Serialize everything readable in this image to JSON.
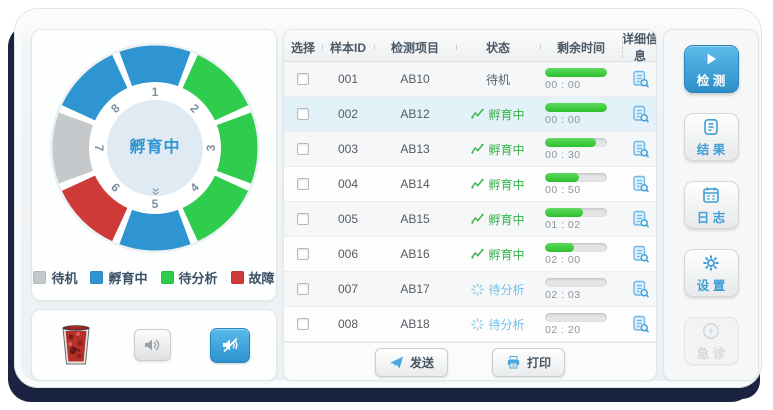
{
  "left_panel": {
    "center_label": "孵育中",
    "expand_chevron": "«",
    "legend": [
      {
        "label": "待机",
        "color": "#c6c9cb"
      },
      {
        "label": "孵育中",
        "color": "#2e94d2"
      },
      {
        "label": "待分析",
        "color": "#2fcc4e"
      },
      {
        "label": "故障",
        "color": "#cd3a37"
      }
    ]
  },
  "chart_data": {
    "type": "pie",
    "variant": "donut-status-ring",
    "center_label": "孵育中",
    "segments": [
      {
        "position": 1,
        "status": "孵育中",
        "color": "#2e94d2"
      },
      {
        "position": 2,
        "status": "待分析",
        "color": "#2fcc4e"
      },
      {
        "position": 3,
        "status": "待分析",
        "color": "#2fcc4e"
      },
      {
        "position": 4,
        "status": "待分析",
        "color": "#2fcc4e"
      },
      {
        "position": 5,
        "status": "孵育中",
        "color": "#2e94d2"
      },
      {
        "position": 6,
        "status": "故障",
        "color": "#cd3a37"
      },
      {
        "position": 7,
        "status": "待机",
        "color": "#c6c9cb"
      },
      {
        "position": 8,
        "status": "孵育中",
        "color": "#2e94d2"
      }
    ],
    "legend_position": "bottom"
  },
  "sound_panel": {
    "icons": [
      "waste-bin-icon",
      "speaker-on-icon",
      "speaker-muted-icon"
    ],
    "muted_button_active": true
  },
  "table": {
    "headers": [
      "选择",
      "样本ID",
      "检测项目",
      "状态",
      "剩余时间",
      "详细信息"
    ],
    "rows": [
      {
        "id": "001",
        "item": "AB10",
        "status": "待机",
        "status_type": "standby",
        "progress": 100,
        "time": "00 : 00",
        "selected": false,
        "checked": false
      },
      {
        "id": "002",
        "item": "AB12",
        "status": "孵育中",
        "status_type": "incubating",
        "progress": 100,
        "time": "00 : 00",
        "selected": true,
        "checked": false
      },
      {
        "id": "003",
        "item": "AB13",
        "status": "孵育中",
        "status_type": "incubating",
        "progress": 83,
        "time": "00 : 30",
        "selected": false,
        "checked": false
      },
      {
        "id": "004",
        "item": "AB14",
        "status": "孵育中",
        "status_type": "incubating",
        "progress": 55,
        "time": "00 : 50",
        "selected": false,
        "checked": false
      },
      {
        "id": "005",
        "item": "AB15",
        "status": "孵育中",
        "status_type": "incubating",
        "progress": 61,
        "time": "01 : 02",
        "selected": false,
        "checked": false
      },
      {
        "id": "006",
        "item": "AB16",
        "status": "孵育中",
        "status_type": "incubating",
        "progress": 47,
        "time": "02 : 00",
        "selected": false,
        "checked": false
      },
      {
        "id": "007",
        "item": "AB17",
        "status": "待分析",
        "status_type": "pending",
        "progress": 0,
        "time": "02 : 03",
        "selected": false,
        "checked": false
      },
      {
        "id": "008",
        "item": "AB18",
        "status": "待分析",
        "status_type": "pending",
        "progress": 0,
        "time": "02 : 20",
        "selected": false,
        "checked": false
      }
    ]
  },
  "footer": {
    "send_label": "发送",
    "print_label": "打印"
  },
  "sidebar": {
    "buttons": [
      {
        "label": "检 测",
        "icon": "play-icon",
        "state": "primary"
      },
      {
        "label": "结 果",
        "icon": "result-doc-icon",
        "state": "normal"
      },
      {
        "label": "日 志",
        "icon": "log-calendar-icon",
        "state": "normal"
      },
      {
        "label": "设 置",
        "icon": "settings-gear-icon",
        "state": "normal"
      },
      {
        "label": "急 诊",
        "icon": "emergency-bolt-icon",
        "state": "disabled"
      }
    ]
  },
  "colors": {
    "accent_blue": "#2e94d2",
    "status_green": "#2fcc4e",
    "fault_red": "#cd3a37",
    "standby_gray": "#c6c9cb",
    "selected_row": "#e3f1f9",
    "frame_shadow": "#1a2440"
  }
}
